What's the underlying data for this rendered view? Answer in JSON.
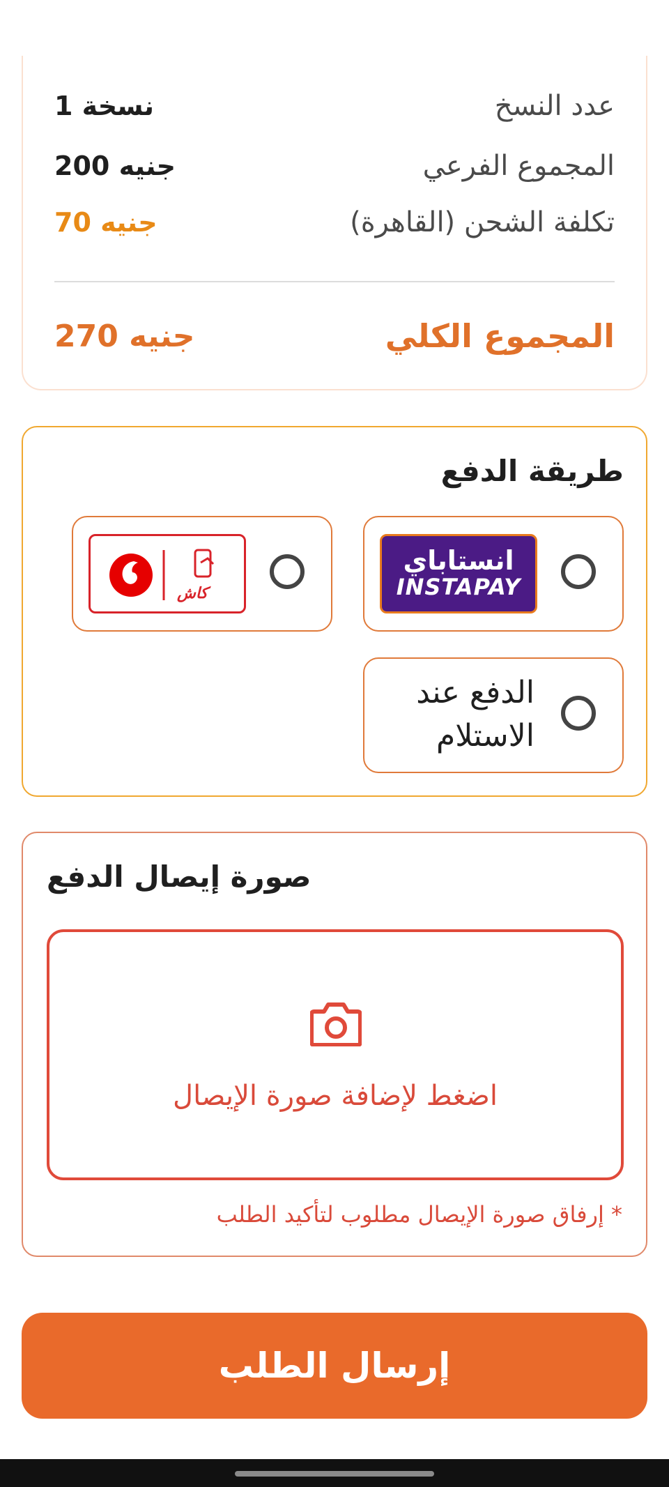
{
  "summary": {
    "copies_label": "عدد النسخ",
    "copies_value": "1 نسخة",
    "subtotal_label": "المجموع الفرعي",
    "subtotal_value": "200 جنيه",
    "shipping_label": "تكلفة الشحن (القاهرة)",
    "shipping_value": "70 جنيه",
    "total_label": "المجموع الكلي",
    "total_value": "270 جنيه"
  },
  "payment": {
    "title": "طريقة الدفع",
    "options": [
      {
        "id": "instapay",
        "logo_ar": "انستاباي",
        "logo_en": "INSTAPAY",
        "selected": false
      },
      {
        "id": "vodafone-cash",
        "logo_ar": "كاش",
        "selected": false
      },
      {
        "id": "cod",
        "label": "الدفع عند الاستلام",
        "selected": false
      }
    ]
  },
  "receipt": {
    "title": "صورة إيصال الدفع",
    "upload_hint": "اضغط لإضافة صورة الإيصال",
    "required_note": "* إرفاق صورة الإيصال مطلوب لتأكيد الطلب"
  },
  "submit_label": "إرسال الطلب",
  "colors": {
    "accent": "#e96a2b",
    "shipping": "#e88a16",
    "error": "#d94a3a",
    "instapay_purple": "#4b1b85",
    "vodafone_red": "#d8232a"
  }
}
